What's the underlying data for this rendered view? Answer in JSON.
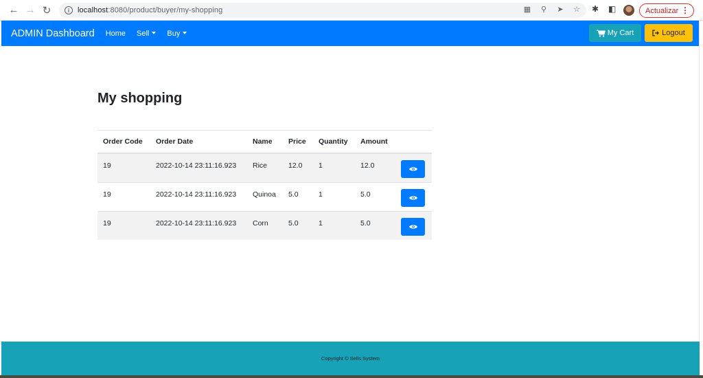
{
  "browser": {
    "url_host": "localhost",
    "url_rest": ":8080/product/buyer/my-shopping",
    "update_label": "Actualizar"
  },
  "navbar": {
    "brand": "ADMIN Dashboard",
    "home": "Home",
    "sell": "Sell",
    "buy": "Buy",
    "cart": "My Cart",
    "logout": "Logout",
    "colors": {
      "primary": "#007bff",
      "info": "#17a2b8",
      "warning": "#ffc107"
    }
  },
  "main": {
    "title": "My shopping",
    "columns": [
      "Order Code",
      "Order Date",
      "Name",
      "Price",
      "Quantity",
      "Amount"
    ],
    "rows": [
      {
        "code": "19",
        "date": "2022-10-14 23:11:16.923",
        "name": "Rice",
        "price": "12.0",
        "quantity": "1",
        "amount": "12.0"
      },
      {
        "code": "19",
        "date": "2022-10-14 23:11:16.923",
        "name": "Quinoa",
        "price": "5.0",
        "quantity": "1",
        "amount": "5.0"
      },
      {
        "code": "19",
        "date": "2022-10-14 23:11:16.923",
        "name": "Corn",
        "price": "5.0",
        "quantity": "1",
        "amount": "5.0"
      }
    ]
  },
  "footer": {
    "text": "Copyright © Sells System"
  }
}
